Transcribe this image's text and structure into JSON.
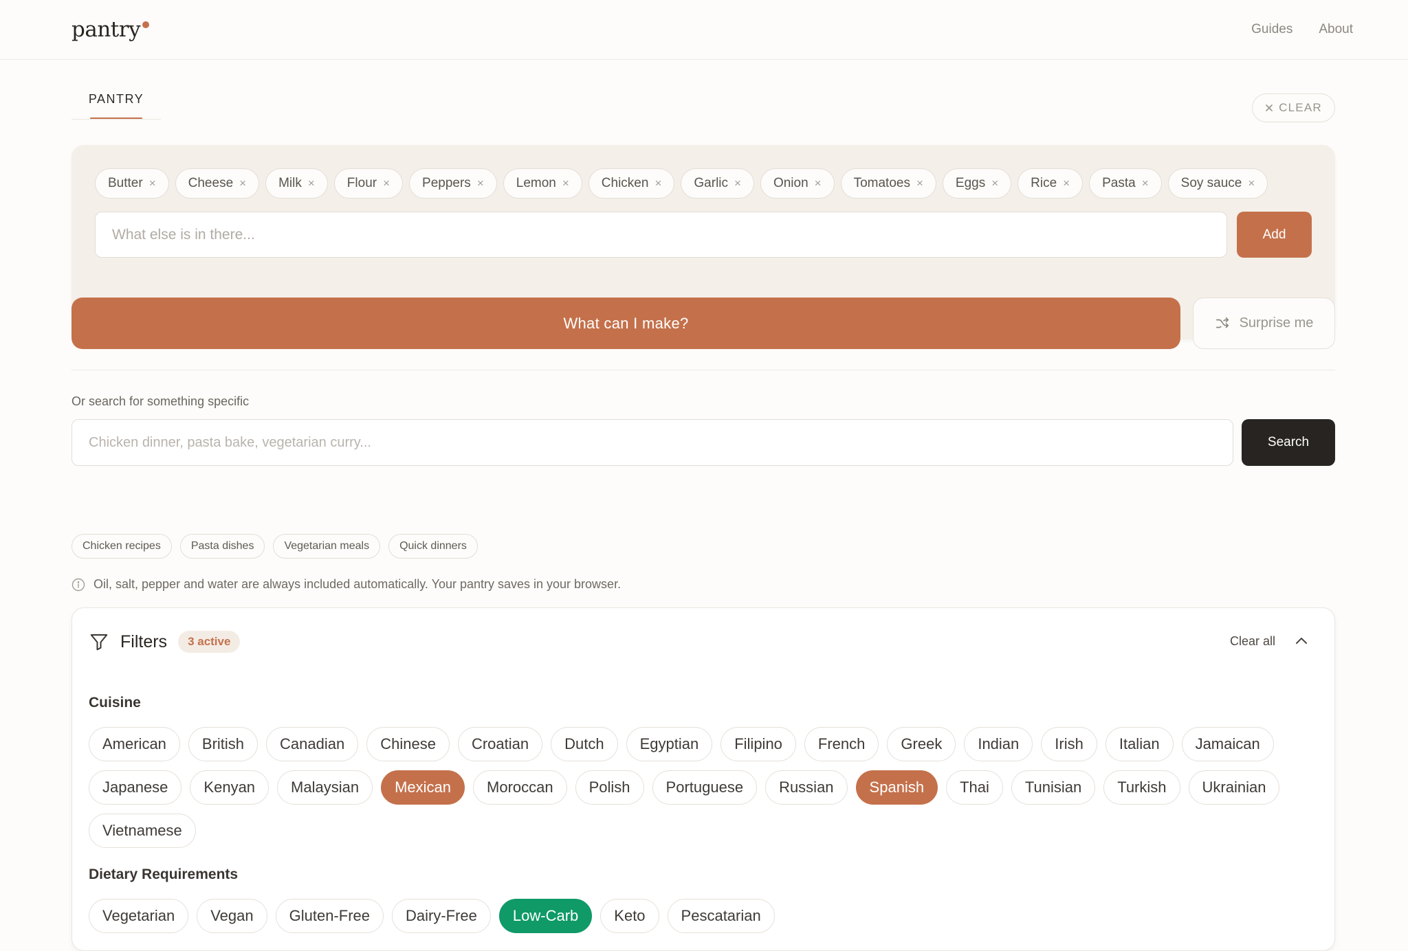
{
  "header": {
    "logo": "pantry",
    "nav": [
      "Guides",
      "About"
    ]
  },
  "tabs": {
    "active": "PANTRY",
    "clear_label": "CLEAR"
  },
  "pantry": {
    "items": [
      "Butter",
      "Cheese",
      "Milk",
      "Flour",
      "Peppers",
      "Lemon",
      "Chicken",
      "Garlic",
      "Onion",
      "Tomatoes",
      "Eggs",
      "Rice",
      "Pasta",
      "Soy sauce"
    ],
    "remove_glyph": "×",
    "input_placeholder": "What else is in there...",
    "add_label": "Add"
  },
  "actions": {
    "make_label": "What can I make?",
    "surprise_label": "Surprise me"
  },
  "search": {
    "label": "Or search for something specific",
    "placeholder": "Chicken dinner, pasta bake, vegetarian curry...",
    "button_label": "Search",
    "suggestions": [
      "Chicken recipes",
      "Pasta dishes",
      "Vegetarian meals",
      "Quick dinners"
    ]
  },
  "info_text": "Oil, salt, pepper and water are always included automatically. Your pantry saves in your browser.",
  "filters": {
    "title": "Filters",
    "badge": "3 active",
    "clear_all": "Clear all",
    "cuisine": {
      "title": "Cuisine",
      "options": [
        {
          "label": "American",
          "selected": false
        },
        {
          "label": "British",
          "selected": false
        },
        {
          "label": "Canadian",
          "selected": false
        },
        {
          "label": "Chinese",
          "selected": false
        },
        {
          "label": "Croatian",
          "selected": false
        },
        {
          "label": "Dutch",
          "selected": false
        },
        {
          "label": "Egyptian",
          "selected": false
        },
        {
          "label": "Filipino",
          "selected": false
        },
        {
          "label": "French",
          "selected": false
        },
        {
          "label": "Greek",
          "selected": false
        },
        {
          "label": "Indian",
          "selected": false
        },
        {
          "label": "Irish",
          "selected": false
        },
        {
          "label": "Italian",
          "selected": false
        },
        {
          "label": "Jamaican",
          "selected": false
        },
        {
          "label": "Japanese",
          "selected": false
        },
        {
          "label": "Kenyan",
          "selected": false
        },
        {
          "label": "Malaysian",
          "selected": false
        },
        {
          "label": "Mexican",
          "selected": true
        },
        {
          "label": "Moroccan",
          "selected": false
        },
        {
          "label": "Polish",
          "selected": false
        },
        {
          "label": "Portuguese",
          "selected": false
        },
        {
          "label": "Russian",
          "selected": false
        },
        {
          "label": "Spanish",
          "selected": true
        },
        {
          "label": "Thai",
          "selected": false
        },
        {
          "label": "Tunisian",
          "selected": false
        },
        {
          "label": "Turkish",
          "selected": false
        },
        {
          "label": "Ukrainian",
          "selected": false
        },
        {
          "label": "Vietnamese",
          "selected": false
        }
      ]
    },
    "dietary": {
      "title": "Dietary Requirements",
      "options": [
        {
          "label": "Vegetarian",
          "selected": false
        },
        {
          "label": "Vegan",
          "selected": false
        },
        {
          "label": "Gluten-Free",
          "selected": false
        },
        {
          "label": "Dairy-Free",
          "selected": false
        },
        {
          "label": "Low-Carb",
          "selected": true
        },
        {
          "label": "Keto",
          "selected": false
        },
        {
          "label": "Pescatarian",
          "selected": false
        }
      ]
    }
  },
  "colors": {
    "accent": "#c4714b",
    "dark": "#272421",
    "diet_selected": "#0f9a68"
  }
}
